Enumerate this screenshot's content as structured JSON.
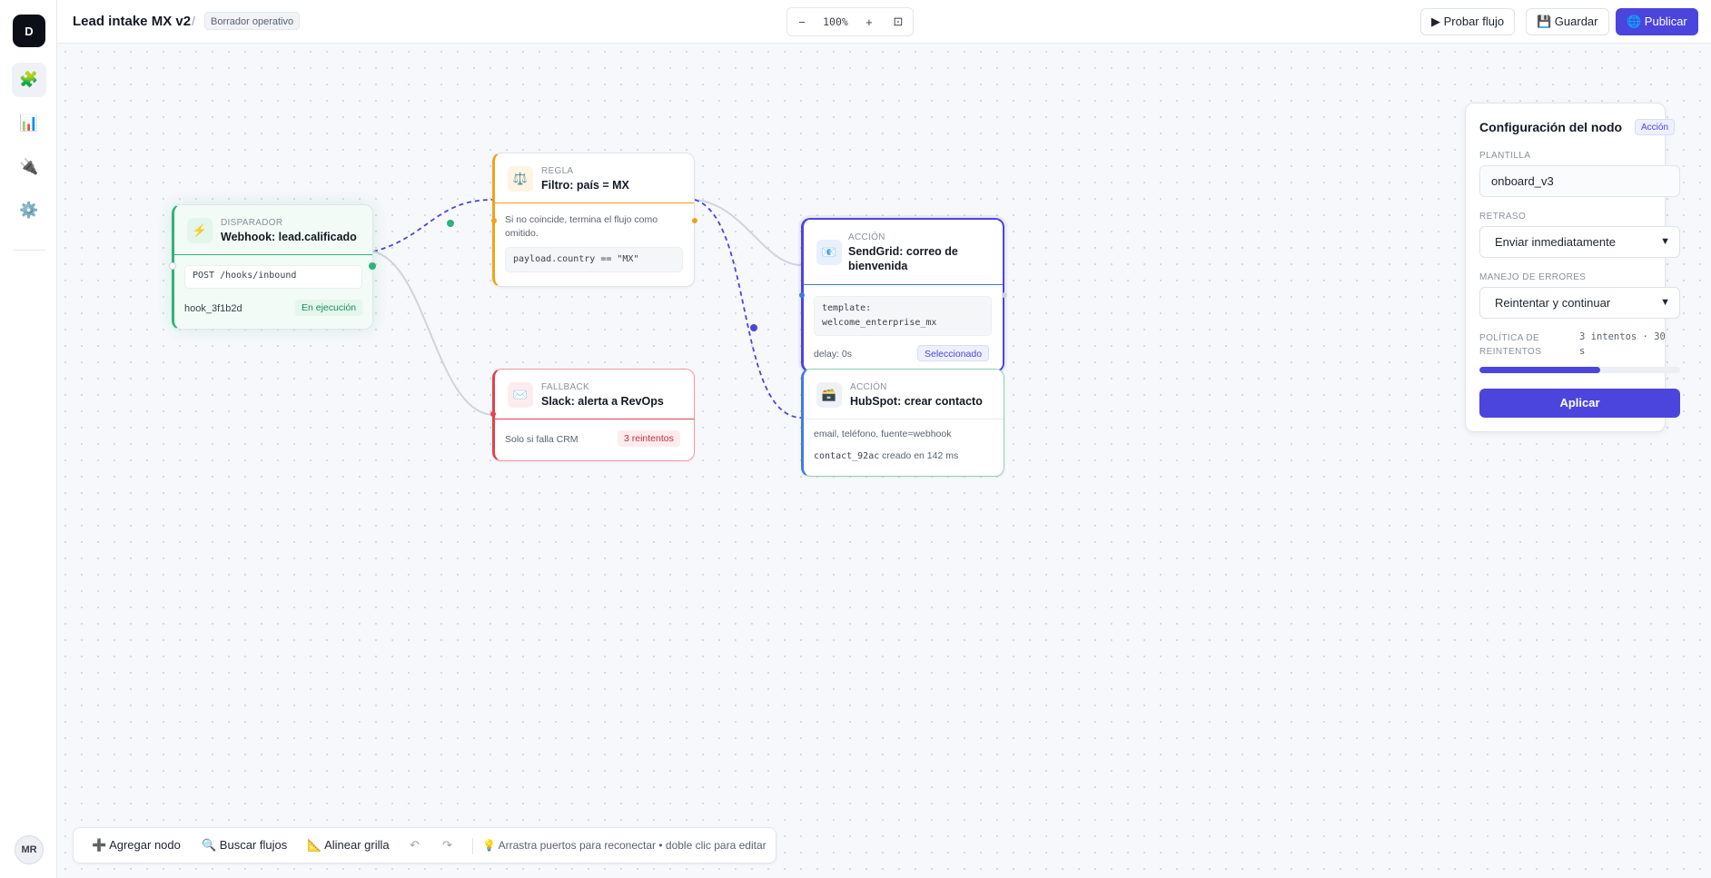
{
  "app": {
    "logo_text": "D",
    "avatar_initials": "MR"
  },
  "rail": {
    "items": [
      {
        "icon": "puzzle-icon",
        "glyph": "🧩"
      },
      {
        "icon": "chart-icon",
        "glyph": "📊"
      },
      {
        "icon": "plug-icon",
        "glyph": "🔌"
      },
      {
        "icon": "gear-icon",
        "glyph": "⚙️"
      }
    ]
  },
  "header": {
    "title": "Lead intake MX v2",
    "separator": "/",
    "status": "Borrador operativo",
    "zoom": {
      "minus": "−",
      "value": "100%",
      "plus": "+",
      "fit": "⊡"
    },
    "actions": {
      "test": "▶ Probar flujo",
      "save": "💾 Guardar",
      "publish": "🌐 Publicar"
    }
  },
  "nodes": {
    "trigger": {
      "type": "DISPARADOR",
      "name": "Webhook: lead.calificado",
      "icon": "⚡",
      "endpoint": "POST /hooks/inbound",
      "id": "hook_3f1b2d",
      "status": "En ejecución"
    },
    "rule": {
      "type": "REGLA",
      "name": "Filtro: país = MX",
      "icon": "⚖️",
      "note": "Si no coincide, termina el flujo como omitido.",
      "expr": "payload.country == \"MX\""
    },
    "fallback": {
      "type": "FALLBACK",
      "name": "Slack: alerta a RevOps",
      "icon": "✉️",
      "note": "Solo si falla CRM",
      "badge": "3 reintentos"
    },
    "sendgrid": {
      "type": "ACCIÓN",
      "name_line1": "SendGrid: correo de",
      "name_line2": "bienvenida",
      "icon": "📧",
      "template_label": "template:",
      "template_value": "welcome_enterprise_mx",
      "delay": "delay: 0s",
      "badge": "Seleccionado"
    },
    "hubspot": {
      "type": "ACCIÓN",
      "name": "HubSpot: crear contacto",
      "icon": "🗃️",
      "fields": "email, teléfono, fuente=webhook",
      "contact_id": "contact_92ac",
      "result": "creado en 142 ms"
    }
  },
  "panel": {
    "title": "Configuración del nodo",
    "badge": "Acción",
    "template_label": "PLANTILLA",
    "template_value": "onboard_v3",
    "delay_label": "RETRASO",
    "delay_value": "Enviar inmediatamente",
    "errors_label": "MANEJO DE ERRORES",
    "errors_value": "Reintentar y continuar",
    "retry_label_1": "POLÍTICA DE",
    "retry_label_2": "REINTENTOS",
    "retry_value_1": "3 intentos · 30",
    "retry_value_2": "s",
    "retry_progress": 0.6,
    "apply": "Aplicar"
  },
  "toolbar": {
    "add": "➕ Agregar nodo",
    "search": "🔍 Buscar flujos",
    "align": "📐 Alinear grilla",
    "undo": "↶",
    "redo": "↷",
    "hint": "💡 Arrastra puertos para reconectar • doble clic para editar"
  },
  "colors": {
    "accent": "#4b45dd",
    "trigger": "#2fb37a",
    "rule": "#f0a31a",
    "fallback": "#e0434f",
    "action": "#3f7be0"
  }
}
